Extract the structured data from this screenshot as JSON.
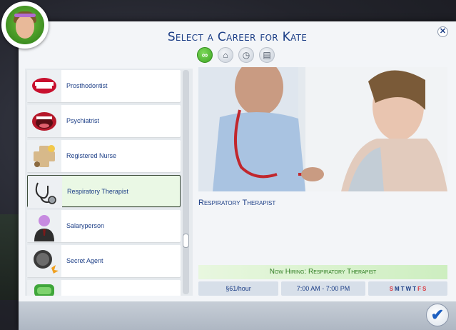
{
  "dialog": {
    "title": "Select a Career for Kate",
    "close_icon": "close-icon",
    "confirm_icon": "checkmark-icon"
  },
  "filters": [
    {
      "icon": "infinity-icon",
      "glyph": "∞",
      "active": true
    },
    {
      "icon": "work-from-home-icon",
      "glyph": "⌂",
      "active": false
    },
    {
      "icon": "part-time-icon",
      "glyph": "◷",
      "active": false
    },
    {
      "icon": "odd-job-icon",
      "glyph": "▤",
      "active": false
    }
  ],
  "careers": [
    {
      "label": "Prosthodontist",
      "icon": "teeth-icon"
    },
    {
      "label": "Psychiatrist",
      "icon": "mouth-icon"
    },
    {
      "label": "Registered Nurse",
      "icon": "medical-cross-icon"
    },
    {
      "label": "Respiratory Therapist",
      "icon": "stethoscope-icon",
      "selected": true
    },
    {
      "label": "Salaryperson",
      "icon": "businessman-icon"
    },
    {
      "label": "Secret Agent",
      "icon": "spy-watch-icon"
    },
    {
      "label": "",
      "icon": "green-career-icon"
    }
  ],
  "details": {
    "career_name": "Respiratory Therapist",
    "hiring_text": "Now Hiring: Respiratory Therapist",
    "pay": "§61/hour",
    "hours": "7:00 AM - 7:00 PM",
    "days": [
      "S",
      "M",
      "T",
      "W",
      "T",
      "F",
      "S"
    ],
    "day_colors": [
      "#d9363e",
      "#1c3e86",
      "#1c3e86",
      "#1c3e86",
      "#1c3e86",
      "#d9363e",
      "#d9363e"
    ]
  }
}
